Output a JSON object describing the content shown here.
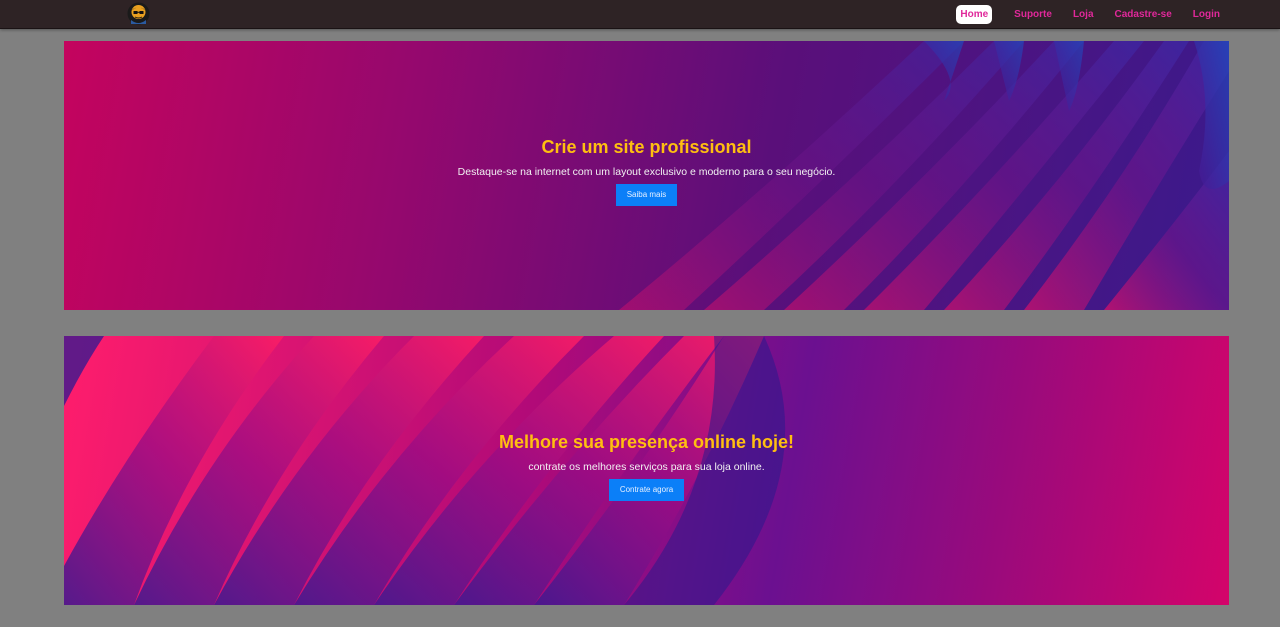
{
  "navbar": {
    "logo": "avatar-logo",
    "links": [
      {
        "label": "Home",
        "active": true
      },
      {
        "label": "Suporte",
        "active": false
      },
      {
        "label": "Loja",
        "active": false
      },
      {
        "label": "Cadastre-se",
        "active": false
      },
      {
        "label": "Login",
        "active": false
      }
    ]
  },
  "banners": [
    {
      "title": "Crie um site profissional",
      "text": "Destaque-se na internet com um layout exclusivo e moderno para o seu negócio.",
      "button": "Saiba mais"
    },
    {
      "title": "Melhore sua presença online hoje!",
      "text": "contrate os melhores serviços para sua loja online.",
      "button": "Contrate agora"
    }
  ],
  "colors": {
    "navbar_bg": "#2e2325",
    "page_bg": "#808080",
    "nav_link": "#e0289a",
    "title": "#ffbf10",
    "button": "#0b7ff8"
  }
}
